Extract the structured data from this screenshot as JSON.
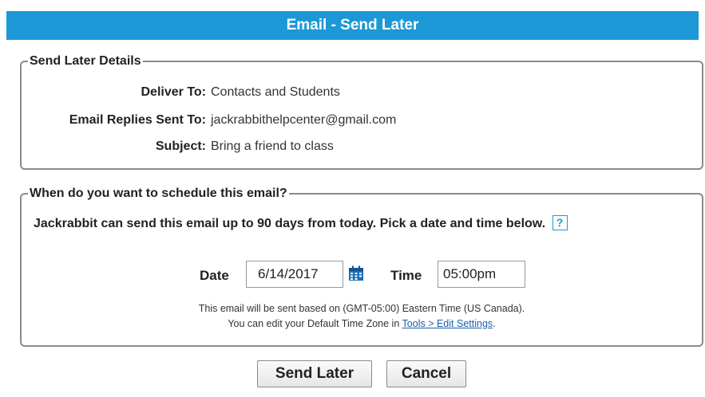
{
  "header": {
    "title": "Email - Send Later"
  },
  "details": {
    "legend": "Send Later Details",
    "rows": [
      {
        "label": "Deliver To:",
        "value": "Contacts and Students"
      },
      {
        "label": "Email Replies Sent To:",
        "value": "jackrabbithelpcenter@gmail.com"
      },
      {
        "label": "Subject:",
        "value": "Bring a friend to class"
      }
    ]
  },
  "schedule": {
    "legend": "When do you want to schedule this email?",
    "info": "Jackrabbit can send this email up to 90 days from today. Pick a date and time below.",
    "help_icon": "?",
    "date_label": "Date",
    "date_value": "6/14/2017",
    "calendar_icon": "calendar-icon",
    "time_label": "Time",
    "time_value": "05:00pm",
    "note_line1": "This email will be sent based on (GMT-05:00) Eastern Time (US Canada).",
    "note_line2_prefix": "You can edit your Default Time Zone in ",
    "note_link": "Tools > Edit Settings",
    "note_line2_suffix": "."
  },
  "actions": {
    "send_later": "Send Later",
    "cancel": "Cancel"
  },
  "colors": {
    "title_bar": "#1b98d5",
    "link": "#1a5fb0",
    "border": "#8a8a8a"
  }
}
